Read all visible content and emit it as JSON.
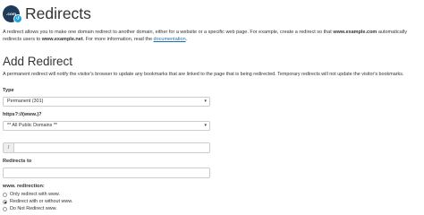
{
  "header": {
    "logo_text": ".com",
    "title": "Redirects"
  },
  "intro": {
    "part1": "A redirect allows you to make one domain redirect to another domain, either for a website or a specific web page. For example, create a redirect so that ",
    "bold1": "www.example.com",
    "part2": " automatically redirects users to ",
    "bold2": "www.example.net",
    "part3": ". For more information, read the ",
    "link": "documentation",
    "part4": "."
  },
  "add_redirect": {
    "title": "Add Redirect",
    "description": "A permanent redirect will notify the visitor's browser to update any bookmarks that are linked to the page that is being redirected. Temporary redirects will not update the visitor's bookmarks."
  },
  "form": {
    "type_label": "Type",
    "type_value": "Permanent (301)",
    "domain_label": "https?://(www.)?",
    "domain_value": "** All Public Domains **",
    "path_prefix": "/",
    "path_value": "",
    "redirects_to_label": "Redirects to",
    "redirects_to_value": "",
    "www_label": "www. redirection:",
    "www_options": [
      {
        "label": "Only redirect with www.",
        "checked": false
      },
      {
        "label": "Redirect with or without www.",
        "checked": true
      },
      {
        "label": "Do Not Redirect www.",
        "checked": false
      }
    ]
  }
}
